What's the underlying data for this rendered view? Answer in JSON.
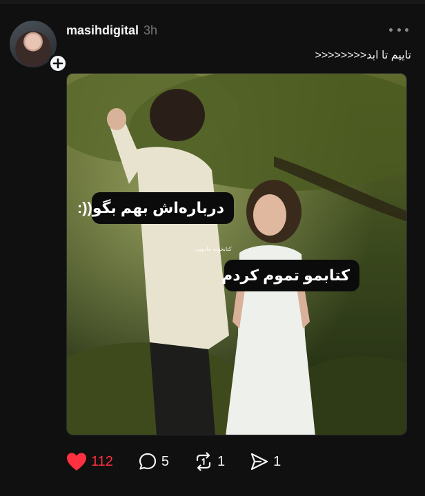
{
  "post": {
    "username": "masihdigital",
    "time": "3h",
    "caption": "تایپم تا ابد<<<<<<<<",
    "image": {
      "bubble_top": "درباره‌اش بهم بگو((:",
      "bubble_bottom": "کتابمو تموم کردم",
      "watermark": "کتابخونه جادویی"
    }
  },
  "actions": {
    "likes": "112",
    "comments": "5",
    "reposts": "1",
    "shares": "1"
  },
  "colors": {
    "background": "#101010",
    "like_red": "#ff3040",
    "text": "#f3f5f7",
    "muted": "#777777"
  },
  "icons": {
    "like": "heart-icon",
    "comment": "comment-icon",
    "repost": "repost-icon",
    "share": "send-icon",
    "more": "more-horizontal-icon",
    "follow": "plus-icon"
  }
}
